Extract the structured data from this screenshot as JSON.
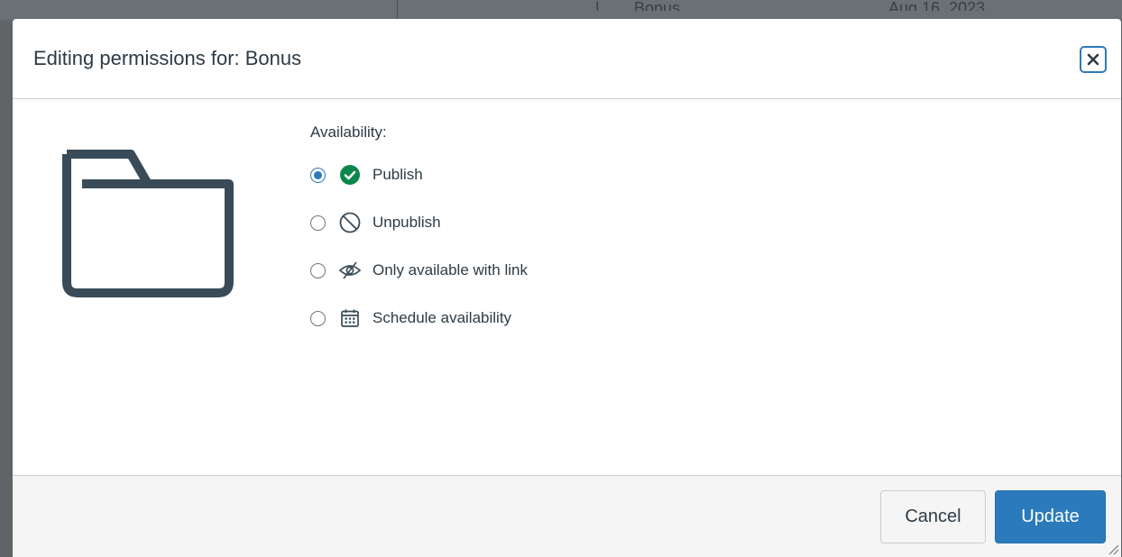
{
  "background": {
    "row_name": "Bonus",
    "row_date": "Aug 16, 2023"
  },
  "dialog": {
    "title": "Editing permissions for: Bonus",
    "close_icon": "close-icon",
    "availability_label": "Availability:",
    "options": [
      {
        "label": "Publish",
        "icon": "published-check-icon",
        "selected": true
      },
      {
        "label": "Unpublish",
        "icon": "unpublish-circle-slash-icon",
        "selected": false
      },
      {
        "label": "Only available with link",
        "icon": "eye-slash-icon",
        "selected": false
      },
      {
        "label": "Schedule availability",
        "icon": "calendar-icon",
        "selected": false
      }
    ],
    "cancel_label": "Cancel",
    "update_label": "Update"
  },
  "colors": {
    "primary": "#2b7abc",
    "success": "#0b874b",
    "text": "#2d3b45",
    "icon": "#394b58"
  }
}
